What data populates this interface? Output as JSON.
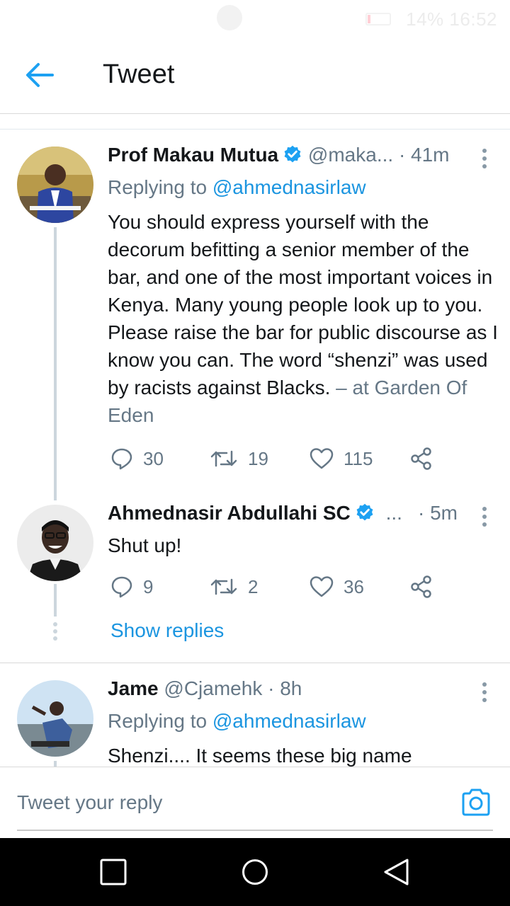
{
  "status_bar": {
    "battery": "14%",
    "time": "16:52"
  },
  "app_bar": {
    "title": "Tweet"
  },
  "tweets": [
    {
      "name": "Prof Makau Mutua",
      "handle": "@maka...",
      "time": "· 41m",
      "replying_prefix": "Replying to ",
      "replying_to": "@ahmednasirlaw",
      "text": "You should express yourself with the decorum befitting a senior member of the bar, and one of the most important voices in Kenya. Many young people look up to you. Please raise the bar for public discourse as I know you can. The word “shenzi” was used by racists against Blacks.",
      "location": " – at Garden Of Eden",
      "replies": "30",
      "retweets": "19",
      "likes": "115"
    },
    {
      "name": "Ahmednasir Abdullahi SC",
      "handle": "...",
      "time": "· 5m",
      "text": "Shut up!",
      "replies": "9",
      "retweets": "2",
      "likes": "36",
      "show_replies": "Show replies"
    },
    {
      "name": "Jame",
      "handle": "@Cjamehk",
      "time": "· 8h",
      "replying_prefix": "Replying to ",
      "replying_to": "@ahmednasirlaw",
      "text": "Shenzi.... It seems these big name"
    }
  ],
  "composer": {
    "placeholder": "Tweet your reply"
  },
  "colors": {
    "accent": "#1da1f2",
    "link": "#1b95e0",
    "muted": "#657786",
    "thread_line": "#ccd6dd"
  },
  "icons": [
    "back-arrow-icon",
    "verified-badge-icon",
    "more-vertical-icon",
    "reply-icon",
    "retweet-icon",
    "like-icon",
    "share-icon",
    "camera-icon",
    "recents-icon",
    "home-icon",
    "back-nav-icon"
  ]
}
